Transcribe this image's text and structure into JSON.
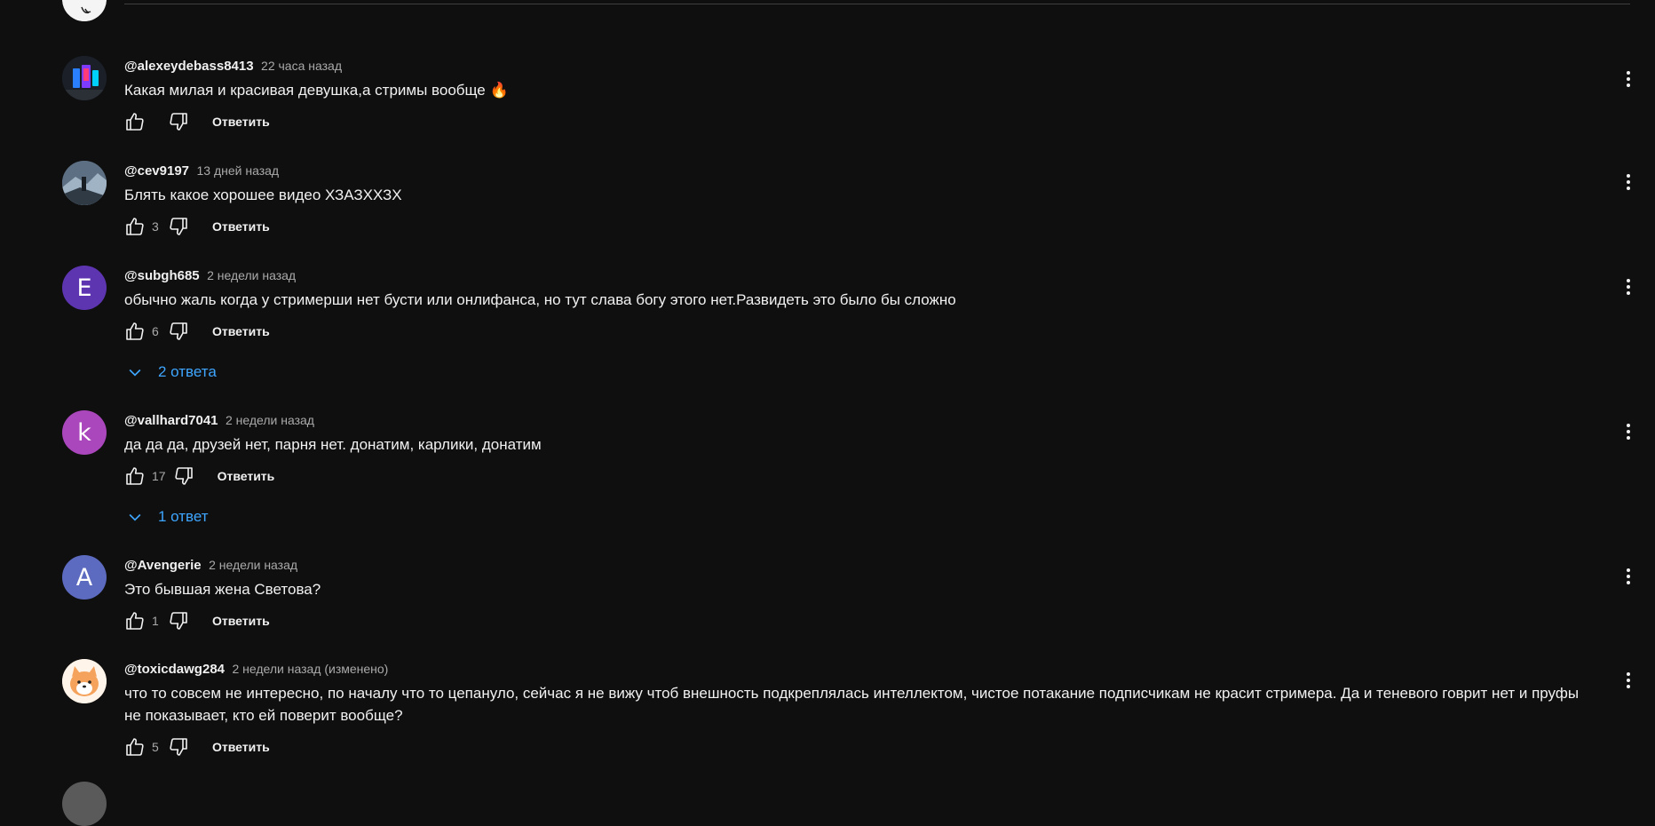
{
  "comments": [
    {
      "author": "@alexeydebass8413",
      "time": "22 часа назад",
      "text": "Какая милая и красивая девушка,а стримы вообще 🔥",
      "likes": "",
      "reply_label": "Ответить",
      "avatar_letter": "",
      "avatar_color": "#1c2430"
    },
    {
      "author": "@cev9197",
      "time": "13 дней назад",
      "text": "Блять какое хорошее видео ХЗАЗХХЗХ",
      "likes": "3",
      "reply_label": "Ответить",
      "avatar_letter": "",
      "avatar_color": "#4a5868"
    },
    {
      "author": "@subgh685",
      "time": "2 недели назад",
      "text": "обычно жаль когда у стримерши нет бусти или онлифанса, но тут слава богу этого нет.Развидеть это было бы сложно",
      "likes": "6",
      "reply_label": "Ответить",
      "avatar_letter": "E",
      "avatar_color": "#5e35b1",
      "replies_label": "2 ответа"
    },
    {
      "author": "@vallhard7041",
      "time": "2 недели назад",
      "text": "да да да, друзей нет, парня нет. донатим, карлики, донатим",
      "likes": "17",
      "reply_label": "Ответить",
      "avatar_letter": "k",
      "avatar_color": "#ab47bc",
      "replies_label": "1 ответ"
    },
    {
      "author": "@Avengerie",
      "time": "2 недели назад",
      "text": "Это бывшая жена Светова?",
      "likes": "1",
      "reply_label": "Ответить",
      "avatar_letter": "A",
      "avatar_color": "#5c6bc0"
    },
    {
      "author": "@toxicdawg284",
      "time": "2 недели назад (изменено)",
      "text": "что то совсем не интересно, по началу что то цепануло, сейчас я не вижу чтоб внешность подкреплялась интеллектом, чистое потакание подписчикам не красит стримера. Да и теневого говрит нет и пруфы не показывает, кто ей поверит вообще?",
      "likes": "5",
      "reply_label": "Ответить",
      "avatar_letter": "",
      "avatar_color": "#fbe3cf"
    }
  ],
  "icons": {
    "like": "thumb-up-icon",
    "dislike": "thumb-down-icon",
    "more": "more-vert-icon",
    "expand": "chevron-down-icon"
  },
  "colors": {
    "background": "#0f0f0f",
    "text": "#f1f1f1",
    "secondary": "#aaaaaa",
    "link": "#3ea6ff"
  }
}
